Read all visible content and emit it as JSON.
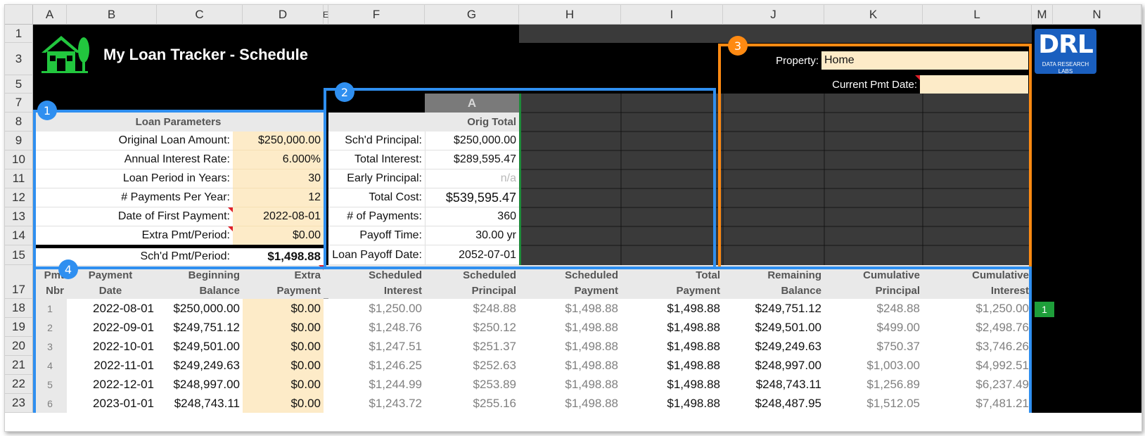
{
  "columns": [
    "A",
    "B",
    "C",
    "D",
    "E",
    "F",
    "G",
    "H",
    "I",
    "J",
    "K",
    "L",
    "M",
    "N"
  ],
  "rows": [
    "1",
    "3",
    "5",
    "7",
    "8",
    "9",
    "10",
    "11",
    "12",
    "13",
    "14",
    "15",
    "17",
    "18",
    "19",
    "20",
    "21",
    "22",
    "23"
  ],
  "title": "My Loan Tracker - Schedule",
  "logo": {
    "text": "DRL",
    "subtitle": "DATA RESEARCH LABS"
  },
  "property": {
    "label": "Property:",
    "value": "Home"
  },
  "current_pmt": {
    "label": "Current Pmt Date:",
    "value": ""
  },
  "loan_params": {
    "header": "Loan Parameters",
    "items": [
      {
        "label": "Original Loan Amount:",
        "value": "$250,000.00"
      },
      {
        "label": "Annual Interest Rate:",
        "value": "6.000%"
      },
      {
        "label": "Loan Period in Years:",
        "value": "30"
      },
      {
        "label": "# Payments Per Year:",
        "value": "12"
      },
      {
        "label": "Date of First Payment:",
        "value": "2022-08-01"
      },
      {
        "label": "Extra Pmt/Period:",
        "value": "$0.00"
      }
    ],
    "sched_label": "Sch'd Pmt/Period:",
    "sched_value": "$1,498.88"
  },
  "summary": {
    "scenario": "A",
    "header": "Orig Total",
    "items": [
      {
        "label": "Sch'd Principal:",
        "value": "$250,000.00"
      },
      {
        "label": "Total Interest:",
        "value": "$289,595.47"
      },
      {
        "label": "Early Principal:",
        "value": "n/a"
      },
      {
        "label": "Total Cost:",
        "value": "$539,595.47"
      },
      {
        "label": "# of Payments:",
        "value": "360"
      },
      {
        "label": "Payoff Time:",
        "value": "30.00 yr"
      },
      {
        "label": "Loan Payoff Date:",
        "value": "2052-07-01"
      }
    ]
  },
  "schedule": {
    "headers": [
      [
        "Pmt",
        "Nbr"
      ],
      [
        "Payment",
        "Date"
      ],
      [
        "Beginning",
        "Balance"
      ],
      [
        "Extra",
        "Payment"
      ],
      [
        "Scheduled",
        "Interest"
      ],
      [
        "Scheduled",
        "Principal"
      ],
      [
        "Scheduled",
        "Payment"
      ],
      [
        "Total",
        "Payment"
      ],
      [
        "Remaining",
        "Balance"
      ],
      [
        "Cumulative",
        "Principal"
      ],
      [
        "Cumulative",
        "Interest"
      ]
    ],
    "rows": [
      [
        "1",
        "2022-08-01",
        "$250,000.00",
        "$0.00",
        "$1,250.00",
        "$248.88",
        "$1,498.88",
        "$1,498.88",
        "$249,751.12",
        "$248.88",
        "$1,250.00"
      ],
      [
        "2",
        "2022-09-01",
        "$249,751.12",
        "$0.00",
        "$1,248.76",
        "$250.12",
        "$1,498.88",
        "$1,498.88",
        "$249,501.00",
        "$499.00",
        "$2,498.76"
      ],
      [
        "3",
        "2022-10-01",
        "$249,501.00",
        "$0.00",
        "$1,247.51",
        "$251.37",
        "$1,498.88",
        "$1,498.88",
        "$249,249.63",
        "$750.37",
        "$3,746.26"
      ],
      [
        "4",
        "2022-11-01",
        "$249,249.63",
        "$0.00",
        "$1,246.25",
        "$252.63",
        "$1,498.88",
        "$1,498.88",
        "$248,997.00",
        "$1,003.00",
        "$4,992.51"
      ],
      [
        "5",
        "2022-12-01",
        "$248,997.00",
        "$0.00",
        "$1,244.99",
        "$253.89",
        "$1,498.88",
        "$1,498.88",
        "$248,743.11",
        "$1,256.89",
        "$6,237.49"
      ],
      [
        "6",
        "2023-01-01",
        "$248,743.11",
        "$0.00",
        "$1,243.72",
        "$255.16",
        "$1,498.88",
        "$1,498.88",
        "$248,487.95",
        "$1,512.05",
        "$7,481.21"
      ]
    ],
    "marker": "1"
  },
  "callouts": [
    "1",
    "2",
    "3",
    "4"
  ],
  "colors": {
    "input_fill": "#fdebc8",
    "blue": "#2f8ff0",
    "orange": "#ff8a12",
    "green": "#1e9e3a"
  }
}
